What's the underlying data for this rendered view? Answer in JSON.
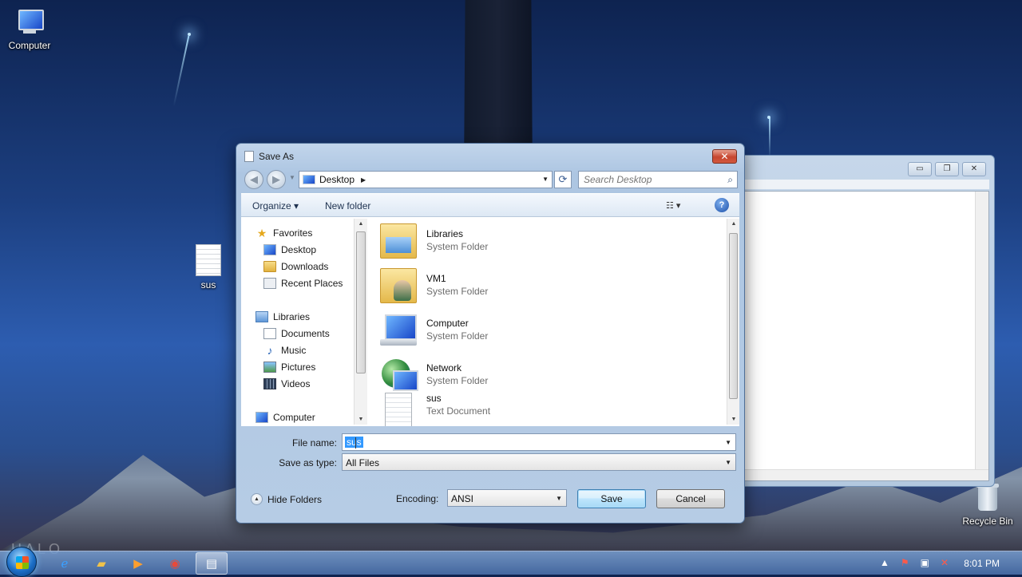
{
  "desktop": {
    "icons": [
      {
        "label": "Computer"
      },
      {
        "label": "sus"
      },
      {
        "label": "Recycle Bin"
      }
    ],
    "wallpaper_text": "HALO"
  },
  "dialog": {
    "title": "Save As",
    "close_glyph": "✕",
    "address": {
      "crumb": "Desktop"
    },
    "search": {
      "placeholder": "Search Desktop"
    },
    "toolbar": {
      "organize": "Organize ▾",
      "new_folder": "New folder",
      "help": "?"
    },
    "nav": {
      "favorites_header": "Favorites",
      "favorites": [
        "Desktop",
        "Downloads",
        "Recent Places"
      ],
      "libraries_header": "Libraries",
      "libraries": [
        "Documents",
        "Music",
        "Pictures",
        "Videos"
      ],
      "computer": "Computer"
    },
    "items": [
      {
        "name": "Libraries",
        "type": "System Folder",
        "icon": "libraries-folder-icon"
      },
      {
        "name": "VM1",
        "type": "System Folder",
        "icon": "user-folder-icon"
      },
      {
        "name": "Computer",
        "type": "System Folder",
        "icon": "computer-icon"
      },
      {
        "name": "Network",
        "type": "System Folder",
        "icon": "network-icon"
      },
      {
        "name": "sus",
        "type": "Text Document",
        "icon": "text-document-icon"
      }
    ],
    "file_name_label": "File name:",
    "file_name_value": "sus",
    "save_as_type_label": "Save as type:",
    "save_as_type_value": "All Files",
    "hide_folders": "Hide Folders",
    "encoding_label": "Encoding:",
    "encoding_value": "ANSI",
    "save_button": "Save",
    "cancel_button": "Cancel"
  },
  "taskbar": {
    "clock": "8:01 PM"
  }
}
